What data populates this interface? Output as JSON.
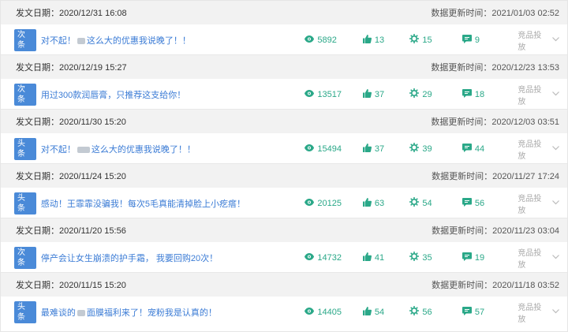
{
  "header_prefix": "发文日期：",
  "update_prefix": "数据更新时间：",
  "action_label": "竞品投放",
  "colors": {
    "accent": "#2aa888",
    "link": "#3a7bd5",
    "tag": "#4a8ad8"
  },
  "articles": [
    {
      "date": "2020/12/31 16:08",
      "updated": "2021/01/03 02:52",
      "tag": "次条",
      "title_parts": [
        "对不起！",
        "这么大的优惠我说晚了！！"
      ],
      "views": "5892",
      "likes": "13",
      "shares": "15",
      "comments": "9"
    },
    {
      "date": "2020/12/19 15:27",
      "updated": "2020/12/23 13:53",
      "tag": "次条",
      "title_parts": [
        "用过300款润唇膏，只推荐这支给你！"
      ],
      "views": "13517",
      "likes": "37",
      "shares": "29",
      "comments": "18"
    },
    {
      "date": "2020/11/30 15:20",
      "updated": "2020/12/03 03:51",
      "tag": "头条",
      "title_parts": [
        "对不起！",
        "这么大的优惠我说晚了！！"
      ],
      "views": "15494",
      "likes": "37",
      "shares": "39",
      "comments": "44"
    },
    {
      "date": "2020/11/24 15:20",
      "updated": "2020/11/27 17:24",
      "tag": "头条",
      "title_parts": [
        "感动！王霏霏没骗我！每次5毛真能清掉脸上小疙瘩！"
      ],
      "views": "20125",
      "likes": "63",
      "shares": "54",
      "comments": "56"
    },
    {
      "date": "2020/11/20 15:56",
      "updated": "2020/11/23 03:04",
      "tag": "次条",
      "title_parts": [
        "停产会让女生崩溃的护手霜， 我要回购20次！"
      ],
      "views": "14732",
      "likes": "41",
      "shares": "35",
      "comments": "19"
    },
    {
      "date": "2020/11/15 15:20",
      "updated": "2020/11/18 03:52",
      "tag": "头条",
      "title_parts": [
        "最难谈的",
        "面膜福利来了！宠粉我是认真的！"
      ],
      "views": "14405",
      "likes": "54",
      "shares": "56",
      "comments": "57"
    }
  ]
}
